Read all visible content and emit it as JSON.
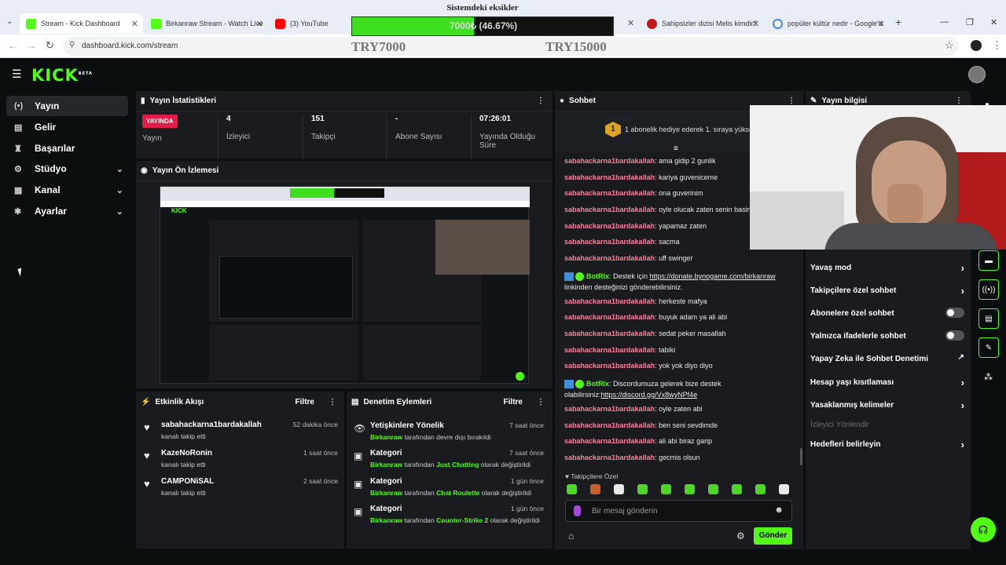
{
  "browser": {
    "tabs": [
      {
        "title": "Stream - Kick Dashboard",
        "color": "#53fc18"
      },
      {
        "title": "Birkanraw Stream - Watch Live",
        "color": "#53fc18"
      },
      {
        "title": "(3) YouTube",
        "color": "#ff0000"
      },
      {
        "title": "Sahipsizler dizisi Melis kimdir?",
        "color": "#c4161c"
      },
      {
        "title": "popüler kültür nedir - Google'd",
        "color": "#4285f4"
      }
    ],
    "url": "dashboard.kick.com/stream"
  },
  "overlay": {
    "title": "Sistemdeki eksikler",
    "progress_text": "7000₺ (46.67%)",
    "progress_fraction": 0.4667,
    "current": "TRY7000",
    "target": "TRY15000"
  },
  "header": {
    "logo": "KICK",
    "beta": "BETA"
  },
  "sidebar": {
    "items": [
      {
        "label": "Yayın",
        "icon": "(•)"
      },
      {
        "label": "Gelir",
        "icon": "▤"
      },
      {
        "label": "Başarılar",
        "icon": "♜"
      },
      {
        "label": "Stüdyo",
        "icon": "⚙"
      },
      {
        "label": "Kanal",
        "icon": "▦"
      },
      {
        "label": "Ayarlar",
        "icon": "✱"
      }
    ]
  },
  "stats": {
    "title": "Yayın İstatistikleri",
    "live_badge": "YAYINDA",
    "items": [
      {
        "value": "",
        "label": "Yayın"
      },
      {
        "value": "4",
        "label": "İzleyici"
      },
      {
        "value": "151",
        "label": "Takipçi"
      },
      {
        "value": "-",
        "label": "Abone Sayısı"
      },
      {
        "value": "07:26:01",
        "label": "Yayında Olduğu Süre"
      }
    ]
  },
  "preview": {
    "title": "Yayın Ön İzlemesi"
  },
  "activity": {
    "title": "Etkinlik Akışı",
    "filter": "Filtre",
    "items": [
      {
        "user": "sabahackarna1bardakallah",
        "action": "kanalı takip etti",
        "time": "52 dakika önce"
      },
      {
        "user": "KazeNoRonin",
        "action": "kanalı takip etti",
        "time": "1 saat önce"
      },
      {
        "user": "CAMPONiSAL",
        "action": "kanalı takip etti",
        "time": "2 saat önce"
      }
    ]
  },
  "moderation": {
    "title": "Denetim Eylemleri",
    "filter": "Filtre",
    "items": [
      {
        "title": "Yetişkinlere Yönelik",
        "actor": "Birkanraw",
        "pre": " tarafından devre dışı bırakıldı",
        "value": "",
        "post": "",
        "time": "7 saat önce"
      },
      {
        "title": "Kategori",
        "actor": "Birkanraw",
        "pre": " tarafından ",
        "value": "Just Chatting",
        "post": " olarak değiştirildi",
        "time": "7 saat önce"
      },
      {
        "title": "Kategori",
        "actor": "Birkanraw",
        "pre": " tarafından ",
        "value": "Chat Roulette",
        "post": " olarak değiştirildi",
        "time": "1 gün önce"
      },
      {
        "title": "Kategori",
        "actor": "Birkanraw",
        "pre": " tarafından ",
        "value": "Counter-Strike 2",
        "post": " olarak değiştirildi",
        "time": "1 gün önce"
      }
    ]
  },
  "chat": {
    "title": "Sohbet",
    "pinned_rank": "1",
    "pinned": "1 abonelik hediye ederek 1. sıraya yükseli",
    "messages": [
      {
        "user": "sabahackarna1bardakallah",
        "text": ": ama gidip 2 gunlik"
      },
      {
        "user": "sabahackarna1bardakallah",
        "text": ": kariya guveniceme"
      },
      {
        "user": "sabahackarna1bardakallah",
        "text": ": ona guverinim"
      },
      {
        "user": "sabahackarna1bardakallah",
        "text": ": oyle olucak zaten senin basin"
      },
      {
        "user": "sabahackarna1bardakallah",
        "text": ": yapamaz zaten"
      },
      {
        "user": "sabahackarna1bardakallah",
        "text": ": sacma"
      },
      {
        "user": "sabahackarna1bardakallah",
        "text": ": uff swinger"
      },
      {
        "user": "sabahackarna1bardakallah",
        "text": ": herkeste mafya"
      },
      {
        "user": "sabahackarna1bardakallah",
        "text": ": buyuk adam ya ali abi"
      },
      {
        "user": "sabahackarna1bardakallah",
        "text": ": sedat peker masallah"
      },
      {
        "user": "sabahackarna1bardakallah",
        "text": ": tabiki"
      },
      {
        "user": "sabahackarna1bardakallah",
        "text": ": yok yok diyo diyo"
      },
      {
        "user": "sabahackarna1bardakallah",
        "text": ": oyle zaten abi"
      },
      {
        "user": "sabahackarna1bardakallah",
        "text": ": ben seni sevdimde"
      },
      {
        "user": "sabahackarna1bardakallah",
        "text": ": ali abi biraz garip"
      },
      {
        "user": "sabahackarna1bardakallah",
        "text": ": gecmis olsun"
      }
    ],
    "bot1": {
      "user": "BotRix",
      "text": ": Destek için ",
      "link": "https://donate.bynogame.com/birkanraw",
      "text2": "linkinden desteğinizi gönderebilirsiniz."
    },
    "bot2": {
      "user": "BotRix",
      "text": ": Discordumuza gelerek bize destek",
      "text2": "olabilirsiniz:",
      "link": "https://discord.gg/Vx8wyNPf4e"
    },
    "mode": "Takipçilere Özel",
    "input_placeholder": "Bir mesaj gönderin",
    "send": "Gönder"
  },
  "info": {
    "title": "Yayın bilgisi",
    "settings": [
      {
        "label": "Yavaş mod",
        "control": "arrow"
      },
      {
        "label": "Takipçilere özel sohbet",
        "control": "arrow"
      },
      {
        "label": "Abonelere özel sohbet",
        "control": "toggle"
      },
      {
        "label": "Yalnızca ifadelerle sohbet",
        "control": "toggle"
      },
      {
        "label": "Yapay Zeka ile Sohbet Denetimi",
        "control": "external"
      },
      {
        "label": "Hesap yaşı kısıtlaması",
        "control": "arrow"
      },
      {
        "label": "Yasaklanmış kelimeler",
        "control": "arrow"
      },
      {
        "label": "İzleyici Yönlendir",
        "control": "none"
      },
      {
        "label": "Hedefleri belirleyin",
        "control": "arrow"
      }
    ]
  }
}
